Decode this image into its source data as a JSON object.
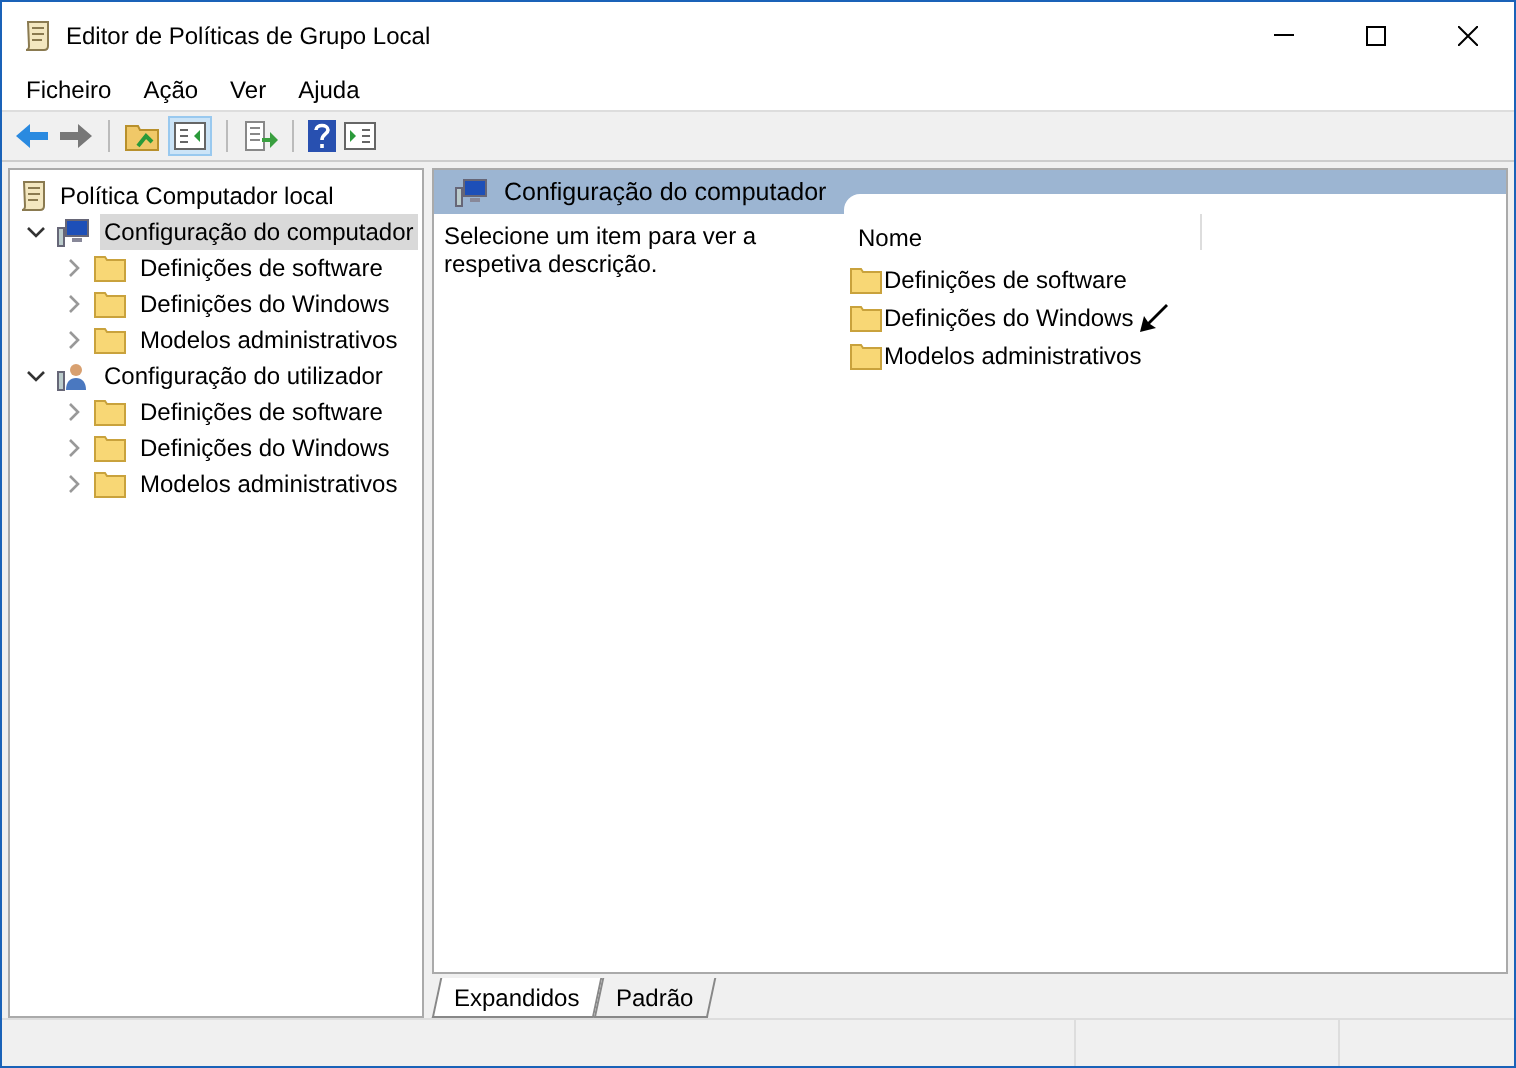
{
  "window": {
    "title": "Editor de Políticas de Grupo Local"
  },
  "menu": [
    "Ficheiro",
    "Ação",
    "Ver",
    "Ajuda"
  ],
  "tree": {
    "label": "Política Computador local",
    "children": [
      {
        "label": "Configuração do computador",
        "kind": "computer",
        "selected": true,
        "expanded": true,
        "children": [
          {
            "label": "Definições de software",
            "kind": "folder",
            "selected": false,
            "expanded": false
          },
          {
            "label": "Definições do Windows",
            "kind": "folder",
            "selected": false,
            "expanded": false
          },
          {
            "label": "Modelos administrativos",
            "kind": "folder",
            "selected": false,
            "expanded": false
          }
        ]
      },
      {
        "label": "Configuração do utilizador",
        "kind": "user",
        "selected": false,
        "expanded": true,
        "children": [
          {
            "label": "Definições de software",
            "kind": "folder",
            "selected": false,
            "expanded": false
          },
          {
            "label": "Definições do Windows",
            "kind": "folder",
            "selected": false,
            "expanded": false
          },
          {
            "label": "Modelos administrativos",
            "kind": "folder",
            "selected": false,
            "expanded": false
          }
        ]
      }
    ]
  },
  "details": {
    "title": "Configuração do computador",
    "description": "Selecione um item para ver a respetiva descrição.",
    "column": "Nome",
    "items": [
      "Definições de software",
      "Definições do Windows",
      "Modelos administrativos"
    ]
  },
  "view_tabs": [
    {
      "label": "Expandidos",
      "selected": true
    },
    {
      "label": "Padrão",
      "selected": false
    }
  ]
}
